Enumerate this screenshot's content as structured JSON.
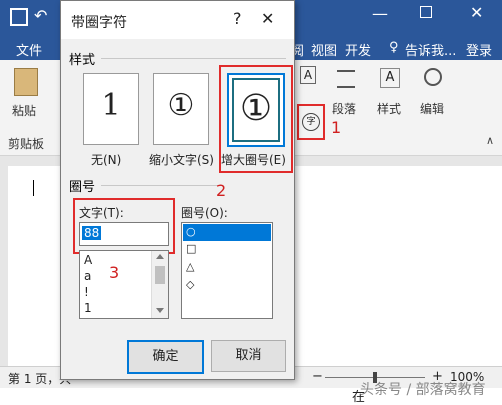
{
  "word": {
    "save_icon": "save-icon",
    "tabs": [
      "文件",
      "阅",
      "视图",
      "开发"
    ],
    "tell_me": "告诉我...",
    "login": "登录",
    "ribbon": {
      "paste": "粘贴",
      "clipboard": "剪贴板",
      "paragraph": "段落",
      "styles": "样式",
      "editing": "编辑",
      "letter_a": "A",
      "enclose_glyph": "字"
    },
    "statusbar": {
      "page": "第 1 页，共",
      "zoom": "100%",
      "minus": "−",
      "plus": "+"
    },
    "watermark": "头条号 / 部落窝教育",
    "doc_char": "在"
  },
  "dialog": {
    "title": "带圈字符",
    "help": "?",
    "close": "✕",
    "style_section": "样式",
    "styles": [
      {
        "glyph": "1",
        "label": "无(N)"
      },
      {
        "glyph": "①",
        "label": "缩小文字(S)"
      },
      {
        "glyph": "①",
        "label": "增大圈号(E)"
      }
    ],
    "circle_section": "圈号",
    "text_label": "文字(T):",
    "text_value": "88",
    "text_list": [
      "A",
      "a",
      "!",
      "1"
    ],
    "enclosure_label": "圈号(O):",
    "enclosures": [
      "○",
      "□",
      "△",
      "◇"
    ],
    "ok": "确定",
    "cancel": "取消"
  },
  "annotations": [
    "1",
    "2",
    "3"
  ],
  "colors": {
    "word_blue": "#2b579a",
    "highlight": "#e02b2b",
    "selection": "#0078d7"
  }
}
